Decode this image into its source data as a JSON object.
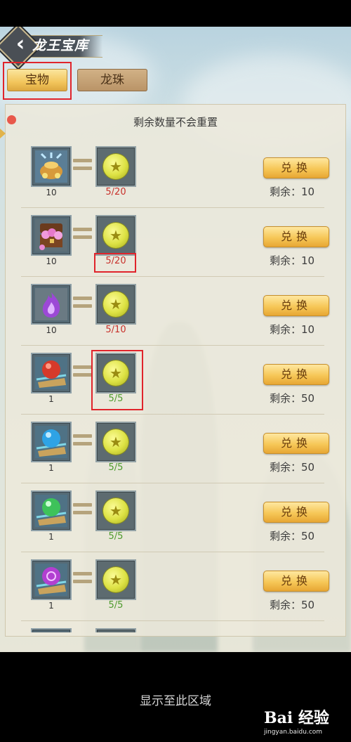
{
  "header": {
    "title": "龙王宝库",
    "back_icon": "back-chevron-icon"
  },
  "tabs": [
    {
      "label": "宝物",
      "selected": true
    },
    {
      "label": "龙珠",
      "selected": false
    }
  ],
  "panel": {
    "notice": "剩余数量不会重置"
  },
  "items": [
    {
      "icon": "treasure-bag-icon",
      "item_count": "10",
      "coin_count": "5/20",
      "coin_status": "limited",
      "button": "兑换",
      "remaining": "剩余：10"
    },
    {
      "icon": "treasure-chest-icon",
      "item_count": "10",
      "coin_count": "5/20",
      "coin_status": "limited",
      "button": "兑换",
      "remaining": "剩余：10"
    },
    {
      "icon": "purple-flame-icon",
      "item_count": "10",
      "coin_count": "5/10",
      "coin_status": "limited",
      "button": "兑换",
      "remaining": "剩余：10"
    },
    {
      "icon": "red-orb-icon",
      "item_count": "1",
      "coin_count": "5/5",
      "coin_status": "enough",
      "button": "兑换",
      "remaining": "剩余：50"
    },
    {
      "icon": "blue-orb-icon",
      "item_count": "1",
      "coin_count": "5/5",
      "coin_status": "enough",
      "button": "兑换",
      "remaining": "剩余：50"
    },
    {
      "icon": "green-orb-icon",
      "item_count": "1",
      "coin_count": "5/5",
      "coin_status": "enough",
      "button": "兑换",
      "remaining": "剩余：50"
    },
    {
      "icon": "purple-orb-icon",
      "item_count": "1",
      "coin_count": "5/5",
      "coin_status": "enough",
      "button": "兑换",
      "remaining": "剩余：50"
    }
  ],
  "colors": {
    "limited": "#c8312b",
    "enough": "#4d9a2c",
    "highlight": "#e0242b"
  },
  "footer": {
    "note": "显示至此区域"
  },
  "watermark": {
    "main": "Bai 经验",
    "sub": "jingyan.baidu.com"
  }
}
